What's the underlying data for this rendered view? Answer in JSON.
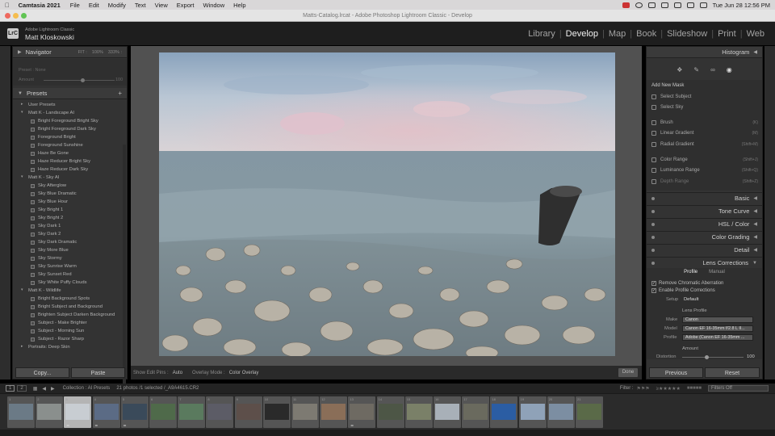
{
  "mac_menu": {
    "app": "Camtasia 2021",
    "items": [
      "File",
      "Edit",
      "Modify",
      "Text",
      "View",
      "Export",
      "Window",
      "Help"
    ],
    "clock": "Tue Jun 28  12:56 PM"
  },
  "window_title": "Matts-Catalog.lrcat - Adobe Photoshop Lightroom Classic - Develop",
  "identity": {
    "logo": "LrC",
    "subtitle": "Adobe Lightroom Classic",
    "name": "Matt Kloskowski"
  },
  "modules": [
    "Library",
    "Develop",
    "Map",
    "Book",
    "Slideshow",
    "Print",
    "Web"
  ],
  "active_module": "Develop",
  "navigator": {
    "title": "Navigator",
    "zoom_options": [
      "FIT :",
      "100%",
      "333% :"
    ],
    "preset_label": "Preset : None",
    "amount_label": "Amount",
    "amount_value": "100"
  },
  "presets": {
    "title": "Presets",
    "add": "+",
    "rows": [
      {
        "type": "group",
        "label": "User Presets",
        "open": false
      },
      {
        "type": "group",
        "label": "Matt K - Landscape AI",
        "open": true
      },
      {
        "type": "item",
        "label": "Bright Foreground Bright Sky"
      },
      {
        "type": "item",
        "label": "Bright Foreground Dark Sky"
      },
      {
        "type": "item",
        "label": "Foreground Bright"
      },
      {
        "type": "item",
        "label": "Foreground Sunshine"
      },
      {
        "type": "item",
        "label": "Haze Be Gone"
      },
      {
        "type": "item",
        "label": "Haze Reducer Bright Sky"
      },
      {
        "type": "item",
        "label": "Haze Reducer Dark Sky"
      },
      {
        "type": "group",
        "label": "Matt K - Sky AI",
        "open": true
      },
      {
        "type": "item",
        "label": "Sky Afterglow"
      },
      {
        "type": "item",
        "label": "Sky Blue Dramatic"
      },
      {
        "type": "item",
        "label": "Sky Blue Hour"
      },
      {
        "type": "item",
        "label": "Sky Bright 1"
      },
      {
        "type": "item",
        "label": "Sky Bright 2"
      },
      {
        "type": "item",
        "label": "Sky Dark 1"
      },
      {
        "type": "item",
        "label": "Sky Dark 2"
      },
      {
        "type": "item",
        "label": "Sky Dark Dramatic"
      },
      {
        "type": "item",
        "label": "Sky More Blue"
      },
      {
        "type": "item",
        "label": "Sky Stormy"
      },
      {
        "type": "item",
        "label": "Sky Sunrise Warm"
      },
      {
        "type": "item",
        "label": "Sky Sunset Red"
      },
      {
        "type": "item",
        "label": "Sky White Puffy Clouds"
      },
      {
        "type": "group",
        "label": "Matt K - Wildlife",
        "open": true
      },
      {
        "type": "item",
        "label": "Bright Background Spots"
      },
      {
        "type": "item",
        "label": "Bright Subject and Background"
      },
      {
        "type": "item",
        "label": "Brighten Subject Darken Background"
      },
      {
        "type": "item",
        "label": "Subject - Make Brighter"
      },
      {
        "type": "item",
        "label": "Subject - Morning Sun"
      },
      {
        "type": "item",
        "label": "Subject - Razor Sharp"
      },
      {
        "type": "group",
        "label": "Portraits: Deep Skin",
        "open": false
      }
    ]
  },
  "copy_label": "Copy...",
  "paste_label": "Paste",
  "toolbar": {
    "show_edit_pins": "Show Edit Pins :",
    "pins_value": "Auto",
    "overlay_mode": "Overlay Mode :",
    "overlay_value": "Color Overlay",
    "done": "Done"
  },
  "histogram": {
    "title": "Histogram"
  },
  "masking": {
    "add_new_mask": "Add New Mask",
    "items": [
      {
        "label": "Select Subject",
        "shortcut": "",
        "dim": false
      },
      {
        "label": "Select Sky",
        "shortcut": "",
        "dim": false
      },
      {
        "label": "Brush",
        "shortcut": "(K)",
        "dim": false
      },
      {
        "label": "Linear Gradient",
        "shortcut": "(M)",
        "dim": false
      },
      {
        "label": "Radial Gradient",
        "shortcut": "(Shift+M)",
        "dim": false
      },
      {
        "label": "Color Range",
        "shortcut": "(Shift+J)",
        "dim": false
      },
      {
        "label": "Luminance Range",
        "shortcut": "(Shift+Q)",
        "dim": false
      },
      {
        "label": "Depth Range",
        "shortcut": "(Shift+Z)",
        "dim": true
      }
    ]
  },
  "sections": [
    "Basic",
    "Tone Curve",
    "HSL / Color",
    "Color Grading",
    "Detail",
    "Lens Corrections"
  ],
  "lens": {
    "tabs": [
      "Profile",
      "Manual"
    ],
    "checks": [
      "Remove Chromatic Aberration",
      "Enable Profile Corrections"
    ],
    "setup_label": "Setup",
    "setup_value": "Default",
    "lens_profile": "Lens Profile",
    "make_label": "Make",
    "make_value": "Canon",
    "model_label": "Model",
    "model_value": "Canon EF 16-35mm f/2.8 L II...",
    "profile_label": "Profile",
    "profile_value": "Adobe (Canon EF 16-35mm ...",
    "amount_title": "Amount",
    "distortion_label": "Distortion",
    "distortion_value": "100"
  },
  "previous_label": "Previous",
  "reset_label": "Reset",
  "filmstrip_header": {
    "view1": "1",
    "view2": "2",
    "collection": "Collection : AI Presets",
    "count": "21 photos /1 selected /_A9A4615.CR2",
    "filter_label": "Filter :",
    "filter_value": "Filters Off"
  },
  "filmstrip": {
    "numbers": [
      "1",
      "2",
      "3",
      "4",
      "5",
      "6",
      "7",
      "8",
      "9",
      "10",
      "11",
      "12",
      "13",
      "14",
      "15",
      "16",
      "17",
      "18",
      "19",
      "20",
      "21"
    ],
    "selected_index": 2,
    "stars": "• • • • •",
    "colors": [
      "#6b7a86",
      "#8a8f8d",
      "#c8cdd2",
      "#5b6b85",
      "#3a4a5a",
      "#4f6a4a",
      "#5a7a5e",
      "#5c5c66",
      "#5d4f4a",
      "#2a2a2a",
      "#7d7a72",
      "#8a6e58",
      "#6e6a62",
      "#4d5646",
      "#7a8068",
      "#a8b0b8",
      "#6a6a5e",
      "#2b5da3",
      "#8fa2b8",
      "#7c8ea2",
      "#5a6a48"
    ]
  }
}
